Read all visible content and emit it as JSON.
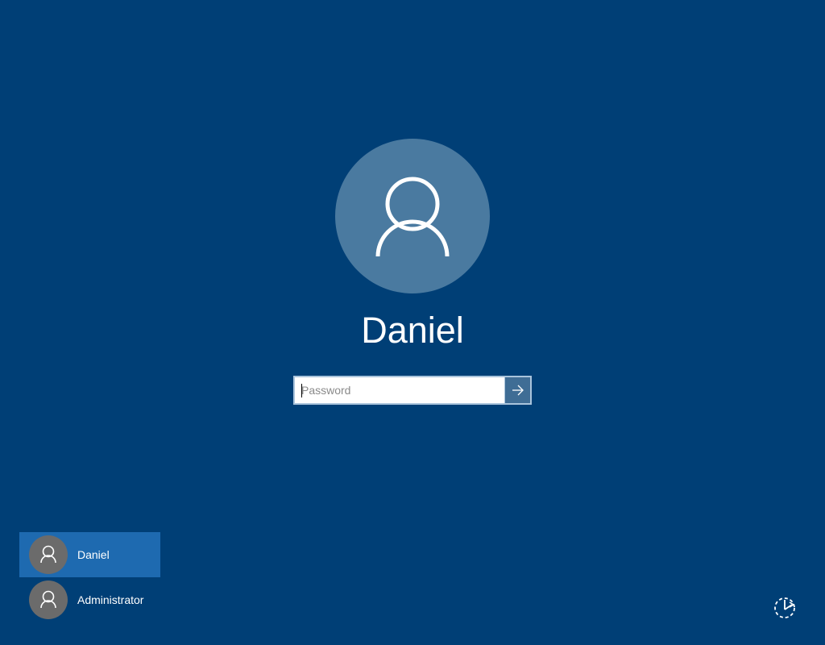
{
  "current_user": {
    "name": "Daniel",
    "icon": "user-icon"
  },
  "password": {
    "placeholder": "Password",
    "value": "",
    "submit_icon": "arrow-right-icon"
  },
  "users": [
    {
      "name": "Daniel",
      "selected": true,
      "icon": "user-icon"
    },
    {
      "name": "Administrator",
      "selected": false,
      "icon": "user-icon"
    }
  ],
  "ease_of_access": {
    "icon": "ease-of-access-icon"
  },
  "colors": {
    "background": "#003f76",
    "avatar_large": "#4a7aa0",
    "avatar_small": "#6b6b6b",
    "selected_user": "#1e6ab0",
    "submit_button": "#3f6d95"
  }
}
